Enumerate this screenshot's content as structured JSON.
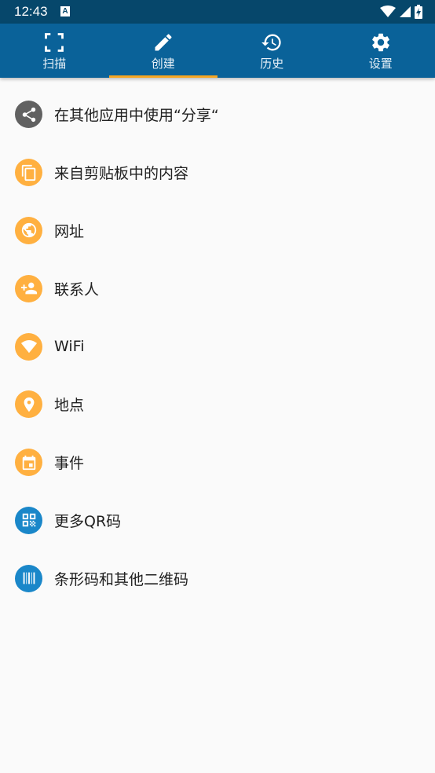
{
  "status_bar": {
    "time": "12:43",
    "notification_icon": "A"
  },
  "tabs": [
    {
      "label": "扫描",
      "icon": "scan-frame-icon",
      "active": false
    },
    {
      "label": "创建",
      "icon": "pencil-icon",
      "active": true
    },
    {
      "label": "历史",
      "icon": "history-icon",
      "active": false
    },
    {
      "label": "设置",
      "icon": "gear-icon",
      "active": false
    }
  ],
  "items": [
    {
      "label": "在其他应用中使用“分享“",
      "icon": "share-icon",
      "color": "#616161"
    },
    {
      "label": "来自剪贴板中的内容",
      "icon": "clipboard-icon",
      "color": "#ffb040"
    },
    {
      "label": "网址",
      "icon": "globe-icon",
      "color": "#ffb040"
    },
    {
      "label": "联系人",
      "icon": "add-contact-icon",
      "color": "#ffb040"
    },
    {
      "label": "WiFi",
      "icon": "wifi-icon",
      "color": "#ffb040"
    },
    {
      "label": "地点",
      "icon": "location-pin-icon",
      "color": "#ffb040"
    },
    {
      "label": "事件",
      "icon": "calendar-icon",
      "color": "#ffb040"
    },
    {
      "label": "更多QR码",
      "icon": "qr-code-icon",
      "color": "#1a87c9"
    },
    {
      "label": "条形码和其他二维码",
      "icon": "barcode-icon",
      "color": "#1a87c9"
    }
  ],
  "colors": {
    "status_bar": "#06476b",
    "toolbar": "#0a6299",
    "tab_indicator": "#f5a623",
    "background": "#fafafa"
  }
}
